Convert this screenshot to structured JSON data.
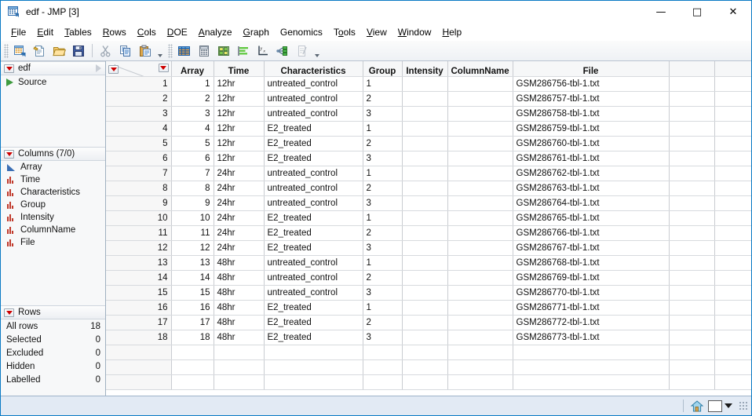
{
  "window": {
    "title": "edf - JMP [3]",
    "icon": "jmp-table-icon",
    "minimize": "—",
    "maximize": "□",
    "close": "✕"
  },
  "menubar": [
    {
      "label": "File",
      "accel": "F"
    },
    {
      "label": "Edit",
      "accel": "E"
    },
    {
      "label": "Tables",
      "accel": "T"
    },
    {
      "label": "Rows",
      "accel": "R"
    },
    {
      "label": "Cols",
      "accel": "C"
    },
    {
      "label": "DOE",
      "accel": "D"
    },
    {
      "label": "Analyze",
      "accel": "A"
    },
    {
      "label": "Graph",
      "accel": "G"
    },
    {
      "label": "Genomics",
      "accel": ""
    },
    {
      "label": "Tools",
      "accel": "o"
    },
    {
      "label": "View",
      "accel": "V"
    },
    {
      "label": "Window",
      "accel": "W"
    },
    {
      "label": "Help",
      "accel": "H"
    }
  ],
  "toolbar": {
    "group1": [
      "new-data-table-icon",
      "new-script-icon",
      "open-file-icon",
      "save-icon"
    ],
    "group2": [
      "cut-icon",
      "copy-icon",
      "paste-icon"
    ],
    "group3": [
      "distribution-icon",
      "tabulate-icon",
      "fit-y-by-x-icon",
      "chart-icon",
      "fit-model-icon",
      "partition-icon",
      "scripting-index-icon"
    ]
  },
  "sidebar": {
    "table_panel": {
      "name": "edf",
      "items": [
        {
          "label": "Source",
          "icon": "green-play-icon"
        }
      ]
    },
    "columns_panel": {
      "title": "Columns (7/0)",
      "items": [
        {
          "label": "Array",
          "icon": "continuous-icon"
        },
        {
          "label": "Time",
          "icon": "nominal-icon"
        },
        {
          "label": "Characteristics",
          "icon": "nominal-icon"
        },
        {
          "label": "Group",
          "icon": "nominal-icon"
        },
        {
          "label": "Intensity",
          "icon": "nominal-icon"
        },
        {
          "label": "ColumnName",
          "icon": "nominal-icon"
        },
        {
          "label": "File",
          "icon": "nominal-icon"
        }
      ]
    },
    "rows_panel": {
      "title": "Rows",
      "items": [
        {
          "label": "All rows",
          "value": "18"
        },
        {
          "label": "Selected",
          "value": "0"
        },
        {
          "label": "Excluded",
          "value": "0"
        },
        {
          "label": "Hidden",
          "value": "0"
        },
        {
          "label": "Labelled",
          "value": "0"
        }
      ]
    }
  },
  "table": {
    "columns": [
      "Array",
      "Time",
      "Characteristics",
      "Group",
      "Intensity",
      "ColumnName",
      "File",
      "",
      ""
    ],
    "rows": [
      {
        "n": "1",
        "Array": "1",
        "Time": "12hr",
        "Characteristics": "untreated_control",
        "Group": "1",
        "Intensity": "",
        "ColumnName": "",
        "File": "GSM286756-tbl-1.txt"
      },
      {
        "n": "2",
        "Array": "2",
        "Time": "12hr",
        "Characteristics": "untreated_control",
        "Group": "2",
        "Intensity": "",
        "ColumnName": "",
        "File": "GSM286757-tbl-1.txt"
      },
      {
        "n": "3",
        "Array": "3",
        "Time": "12hr",
        "Characteristics": "untreated_control",
        "Group": "3",
        "Intensity": "",
        "ColumnName": "",
        "File": "GSM286758-tbl-1.txt"
      },
      {
        "n": "4",
        "Array": "4",
        "Time": "12hr",
        "Characteristics": "E2_treated",
        "Group": "1",
        "Intensity": "",
        "ColumnName": "",
        "File": "GSM286759-tbl-1.txt"
      },
      {
        "n": "5",
        "Array": "5",
        "Time": "12hr",
        "Characteristics": "E2_treated",
        "Group": "2",
        "Intensity": "",
        "ColumnName": "",
        "File": "GSM286760-tbl-1.txt"
      },
      {
        "n": "6",
        "Array": "6",
        "Time": "12hr",
        "Characteristics": "E2_treated",
        "Group": "3",
        "Intensity": "",
        "ColumnName": "",
        "File": "GSM286761-tbl-1.txt"
      },
      {
        "n": "7",
        "Array": "7",
        "Time": "24hr",
        "Characteristics": "untreated_control",
        "Group": "1",
        "Intensity": "",
        "ColumnName": "",
        "File": "GSM286762-tbl-1.txt"
      },
      {
        "n": "8",
        "Array": "8",
        "Time": "24hr",
        "Characteristics": "untreated_control",
        "Group": "2",
        "Intensity": "",
        "ColumnName": "",
        "File": "GSM286763-tbl-1.txt"
      },
      {
        "n": "9",
        "Array": "9",
        "Time": "24hr",
        "Characteristics": "untreated_control",
        "Group": "3",
        "Intensity": "",
        "ColumnName": "",
        "File": "GSM286764-tbl-1.txt"
      },
      {
        "n": "10",
        "Array": "10",
        "Time": "24hr",
        "Characteristics": "E2_treated",
        "Group": "1",
        "Intensity": "",
        "ColumnName": "",
        "File": "GSM286765-tbl-1.txt"
      },
      {
        "n": "11",
        "Array": "11",
        "Time": "24hr",
        "Characteristics": "E2_treated",
        "Group": "2",
        "Intensity": "",
        "ColumnName": "",
        "File": "GSM286766-tbl-1.txt"
      },
      {
        "n": "12",
        "Array": "12",
        "Time": "24hr",
        "Characteristics": "E2_treated",
        "Group": "3",
        "Intensity": "",
        "ColumnName": "",
        "File": "GSM286767-tbl-1.txt"
      },
      {
        "n": "13",
        "Array": "13",
        "Time": "48hr",
        "Characteristics": "untreated_control",
        "Group": "1",
        "Intensity": "",
        "ColumnName": "",
        "File": "GSM286768-tbl-1.txt"
      },
      {
        "n": "14",
        "Array": "14",
        "Time": "48hr",
        "Characteristics": "untreated_control",
        "Group": "2",
        "Intensity": "",
        "ColumnName": "",
        "File": "GSM286769-tbl-1.txt"
      },
      {
        "n": "15",
        "Array": "15",
        "Time": "48hr",
        "Characteristics": "untreated_control",
        "Group": "3",
        "Intensity": "",
        "ColumnName": "",
        "File": "GSM286770-tbl-1.txt"
      },
      {
        "n": "16",
        "Array": "16",
        "Time": "48hr",
        "Characteristics": "E2_treated",
        "Group": "1",
        "Intensity": "",
        "ColumnName": "",
        "File": "GSM286771-tbl-1.txt"
      },
      {
        "n": "17",
        "Array": "17",
        "Time": "48hr",
        "Characteristics": "E2_treated",
        "Group": "2",
        "Intensity": "",
        "ColumnName": "",
        "File": "GSM286772-tbl-1.txt"
      },
      {
        "n": "18",
        "Array": "18",
        "Time": "48hr",
        "Characteristics": "E2_treated",
        "Group": "3",
        "Intensity": "",
        "ColumnName": "",
        "File": "GSM286773-tbl-1.txt"
      }
    ]
  },
  "statusbar": {
    "home_icon": "home-icon",
    "window_select_icon": "window-select-icon",
    "dropdown_icon": "chevron-down-icon",
    "resize_icon": "resize-grip-icon"
  },
  "colors": {
    "window_border": "#0a7ac4",
    "accent_red": "#cc0000",
    "continuous_blue": "#3b6fb5",
    "nominal_red": "#c0392b",
    "statusbar_bg": "#e2eaf4"
  }
}
